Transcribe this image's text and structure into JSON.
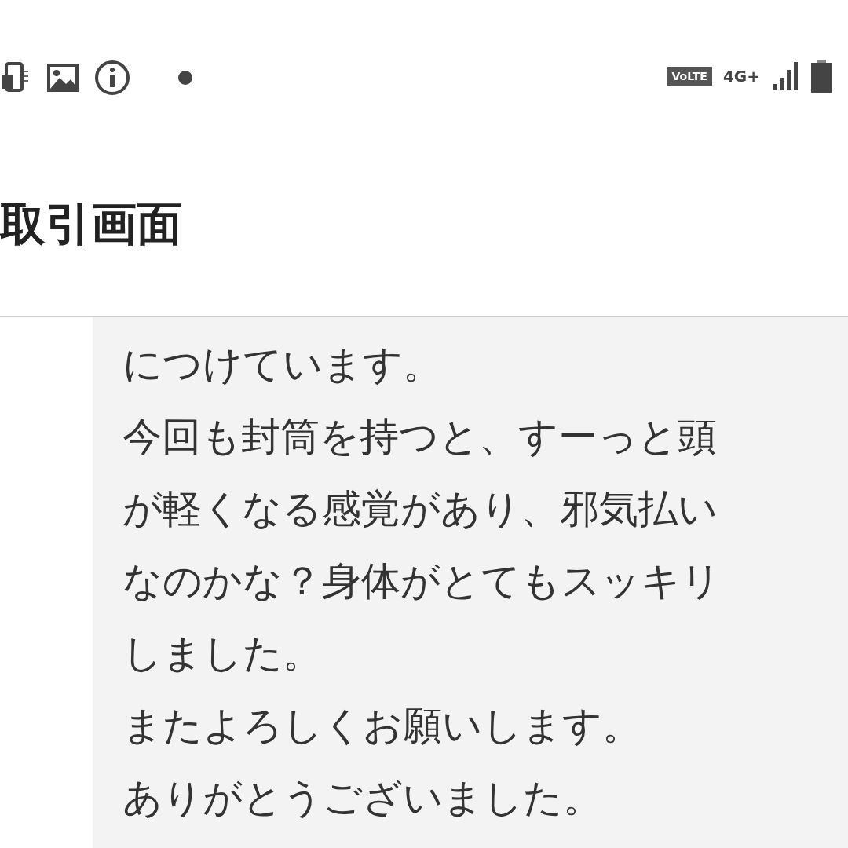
{
  "status_bar": {
    "volte": "VoLTE",
    "network": "4G+"
  },
  "header": {
    "title": "取引画面"
  },
  "message": {
    "lines": [
      "につけています。",
      "今回も封筒を持つと、すーっと頭",
      "が軽くなる感覚があり、邪気払い",
      "なのかな？身体がとてもスッキリ",
      "しました。",
      "またよろしくお願いします。",
      "ありがとうございました。"
    ]
  }
}
